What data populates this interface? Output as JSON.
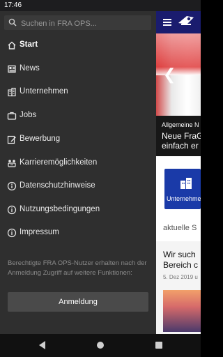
{
  "status_bar": {
    "time": "17:46"
  },
  "drawer": {
    "search_placeholder": "Suchen in FRA OPS...",
    "items": [
      {
        "label": "Start",
        "icon": "home-icon",
        "active": true
      },
      {
        "label": "News",
        "icon": "news-icon"
      },
      {
        "label": "Unternehmen",
        "icon": "building-icon"
      },
      {
        "label": "Jobs",
        "icon": "briefcase-icon"
      },
      {
        "label": "Bewerbung",
        "icon": "edit-icon"
      },
      {
        "label": "Karrieremöglichkeiten",
        "icon": "career-icon"
      },
      {
        "label": "Datenschutzhinweise",
        "icon": "info-icon"
      },
      {
        "label": "Nutzungsbedingungen",
        "icon": "info-icon"
      },
      {
        "label": "Impressum",
        "icon": "info-icon"
      }
    ],
    "note": "Berechtigte FRA OPS-Nutzer erhalten nach der Anmeldung Zugriff auf weitere Funktionen:",
    "login_label": "Anmeldung"
  },
  "background": {
    "news_kicker": "Allgemeine N",
    "news_title_1": "Neue FraG",
    "news_title_2": "einfach er",
    "tile_label": "Unternehmen",
    "section_label": "aktuelle S",
    "card_title_1": "Wir such",
    "card_title_2": "Bereich c",
    "card_date": "5. Dez 2019 u"
  },
  "colors": {
    "topbar": "#1a1c6e",
    "tile": "#1a3aa8",
    "drawer": "#2f2f2f"
  }
}
